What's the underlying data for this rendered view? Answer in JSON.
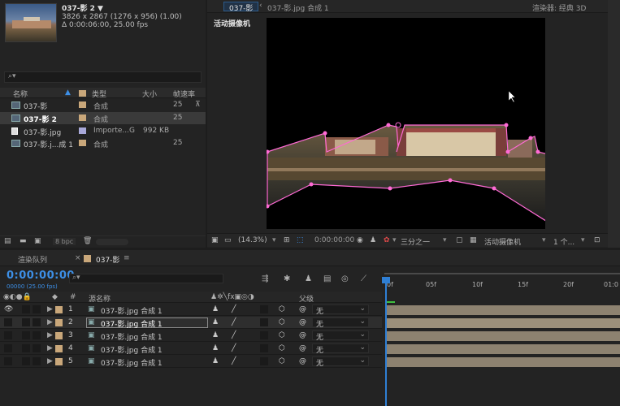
{
  "project": {
    "comp_name": "037-影 2 ▼",
    "comp_dims": "3826 x 2867  (1276 x 956) (1.00)",
    "comp_duration": "Δ 0:00:06:00, 25.00 fps",
    "search_icon": "⌕▾",
    "columns": {
      "name": "名称",
      "type": "类型",
      "size": "大小",
      "fps": "帧速率"
    },
    "items": [
      {
        "name": "037-影",
        "type": "合成",
        "size": "",
        "fps": "25",
        "swatch": "#c9a77a",
        "selected": false
      },
      {
        "name": "037-影 2",
        "type": "合成",
        "size": "",
        "fps": "25",
        "swatch": "#c9a77a",
        "selected": true
      },
      {
        "name": "037-影.jpg",
        "type": "Importe...G",
        "size": "992 KB",
        "fps": "",
        "swatch": "#a8a8d8",
        "selected": false
      },
      {
        "name": "037-影.j...成 1",
        "type": "合成",
        "size": "",
        "fps": "25",
        "swatch": "#c9a77a",
        "selected": false
      }
    ],
    "bpc": "8 bpc"
  },
  "viewer": {
    "tab_label": "037-影",
    "breadcrumb": "037-影.jpg 合成 1",
    "renderer": "渲染器:  经典 3D",
    "camera_label": "活动摄像机",
    "zoom": "(14.3%)",
    "timecode": "0:00:00:00",
    "resolution": "三分之一",
    "view": "活动摄像机",
    "views_count": "1 个..."
  },
  "timeline": {
    "render_queue_tab": "渲染队列",
    "comp_tab": "037-影",
    "current_time": "0:00:00:00",
    "fps_label": "00000 (25.00 fps)",
    "search_icon": "⌕▾",
    "col_source": "源名称",
    "col_parent": "父级",
    "col_num": "#",
    "ticks": [
      "0f",
      "05f",
      "10f",
      "15f",
      "20f",
      "01:0"
    ],
    "layers": [
      {
        "num": "1",
        "name": "037-影.jpg 合成 1",
        "parent": "无",
        "selected": false,
        "visible": true
      },
      {
        "num": "2",
        "name": "037-影.jpg 合成 1",
        "parent": "无",
        "selected": true,
        "visible": false
      },
      {
        "num": "3",
        "name": "037-影.jpg 合成 1",
        "parent": "无",
        "selected": false,
        "visible": false
      },
      {
        "num": "4",
        "name": "037-影.jpg 合成 1",
        "parent": "无",
        "selected": false,
        "visible": false
      },
      {
        "num": "5",
        "name": "037-影.jpg 合成 1",
        "parent": "无",
        "selected": false,
        "visible": false
      }
    ]
  }
}
